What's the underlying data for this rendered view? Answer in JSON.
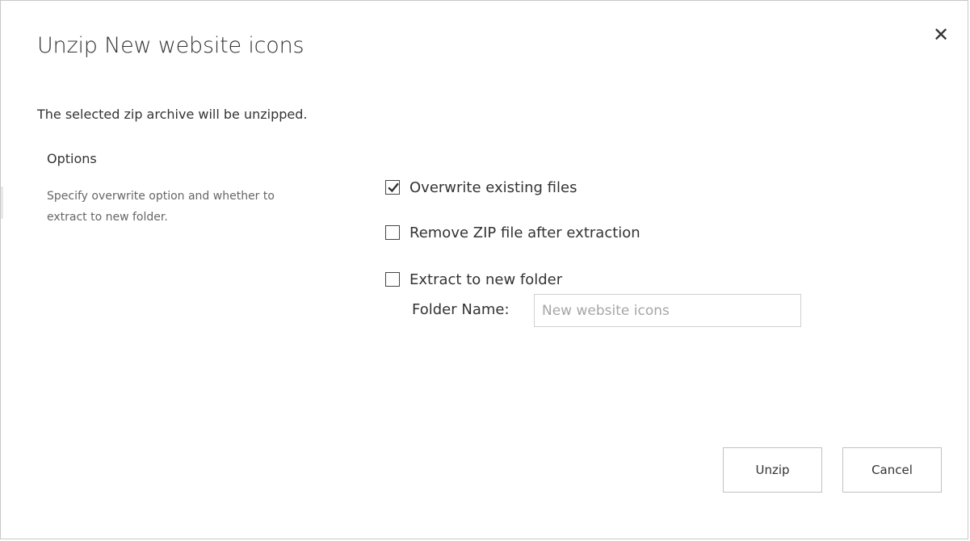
{
  "dialog": {
    "title": "Unzip New website icons",
    "close_icon": "close-icon",
    "description": "The selected zip archive will be unzipped."
  },
  "options": {
    "section_title": "Options",
    "section_help": "Specify overwrite option and whether to extract to new folder.",
    "checkboxes": [
      {
        "label": "Overwrite existing files",
        "checked": true
      },
      {
        "label": "Remove ZIP file after extraction",
        "checked": false
      },
      {
        "label": "Extract to new folder",
        "checked": false
      }
    ],
    "folder_name": {
      "label": "Folder Name:",
      "value": "",
      "placeholder": "New website icons"
    }
  },
  "buttons": {
    "unzip_label": "Unzip",
    "cancel_label": "Cancel"
  },
  "colors": {
    "text": "#333333",
    "help_text": "#666666",
    "border": "#c0c0c0",
    "placeholder": "#a6a6a6"
  }
}
